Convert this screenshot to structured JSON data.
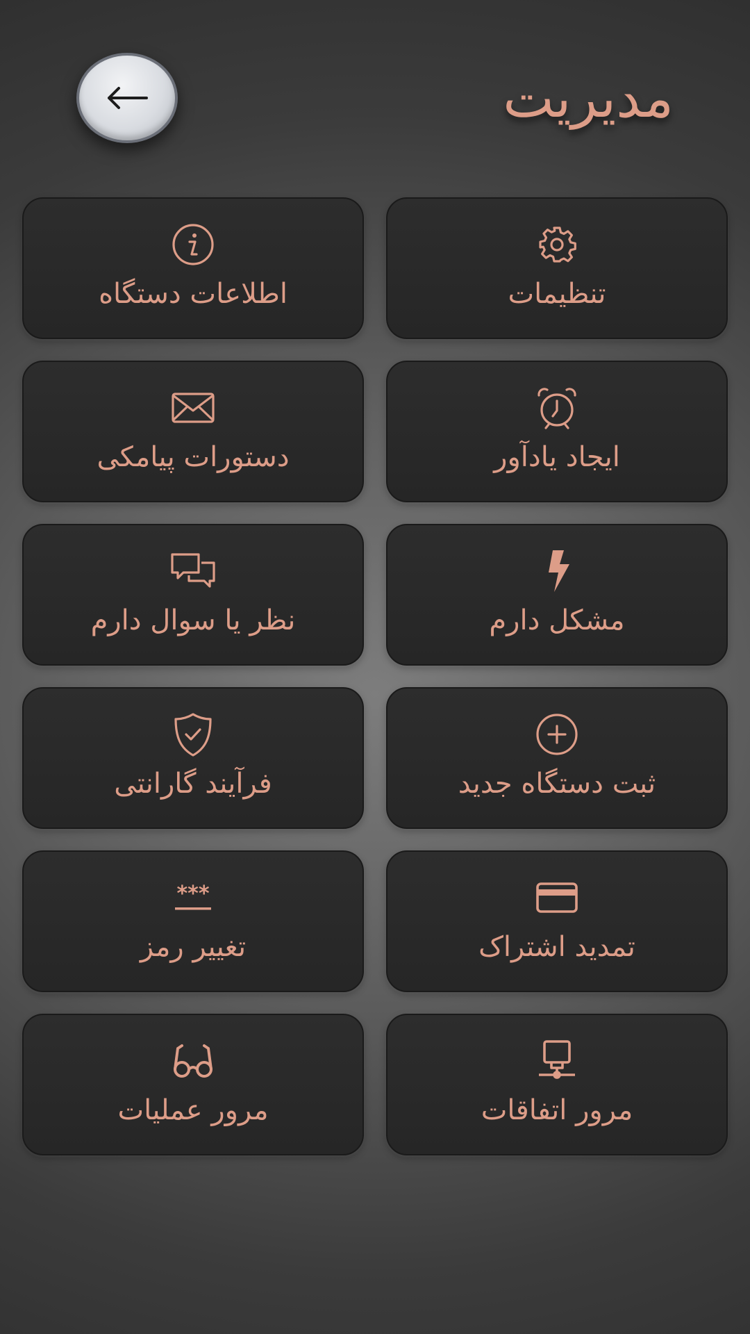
{
  "header": {
    "title": "مدیریت",
    "back_icon": "arrow-left-icon"
  },
  "colors": {
    "accent": "#dd9d88",
    "tile_bg": "#2a2a2a",
    "back_button_bg": "#d9dce1"
  },
  "menu": [
    {
      "label": "تنظیمات",
      "icon": "gear-icon"
    },
    {
      "label": "اطلاعات دستگاه",
      "icon": "info-icon"
    },
    {
      "label": "ایجاد یادآور",
      "icon": "alarm-clock-icon"
    },
    {
      "label": "دستورات پیامکی",
      "icon": "envelope-icon"
    },
    {
      "label": "مشکل دارم",
      "icon": "lightning-icon"
    },
    {
      "label": "نظر یا سوال دارم",
      "icon": "chat-bubbles-icon"
    },
    {
      "label": "ثبت دستگاه جدید",
      "icon": "plus-circle-icon"
    },
    {
      "label": "فرآیند گارانتی",
      "icon": "shield-check-icon"
    },
    {
      "label": "تمدید اشتراک",
      "icon": "credit-card-icon"
    },
    {
      "label": "تغییر رمز",
      "icon": "password-icon"
    },
    {
      "label": "مرور اتفاقات",
      "icon": "monitor-network-icon"
    },
    {
      "label": "مرور عملیات",
      "icon": "glasses-icon"
    }
  ]
}
